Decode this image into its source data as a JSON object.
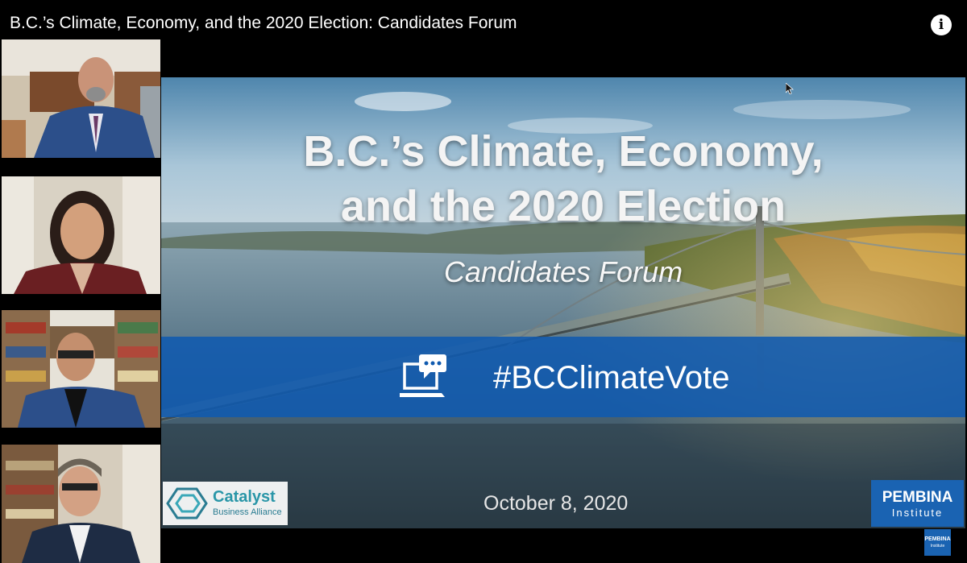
{
  "video": {
    "title": "B.C.’s Climate, Economy, and the 2020 Election: Candidates Forum",
    "info_glyph": "i",
    "info_icon": "info-icon"
  },
  "participants": [
    {
      "kind": "video tile"
    },
    {
      "kind": "video tile"
    },
    {
      "kind": "video tile"
    },
    {
      "kind": "video tile"
    }
  ],
  "slide": {
    "title_line1": "B.C.’s Climate, Economy,",
    "title_line2": "and the 2020 Election",
    "subtitle": "Candidates Forum",
    "hashtag": "#BCClimateVote",
    "hashtag_icon": "laptop-chat-icon",
    "date": "October 8, 2020",
    "band_color": "#105aaf",
    "sponsor_left": {
      "name": "Catalyst",
      "tagline": "Business Alliance",
      "color": "#2a96a8"
    },
    "sponsor_right": {
      "name": "PEMBINA",
      "tagline": "Institute",
      "color": "#1a63b2"
    }
  },
  "watermark": {
    "name": "PEMBINA",
    "tagline": "Institute"
  }
}
